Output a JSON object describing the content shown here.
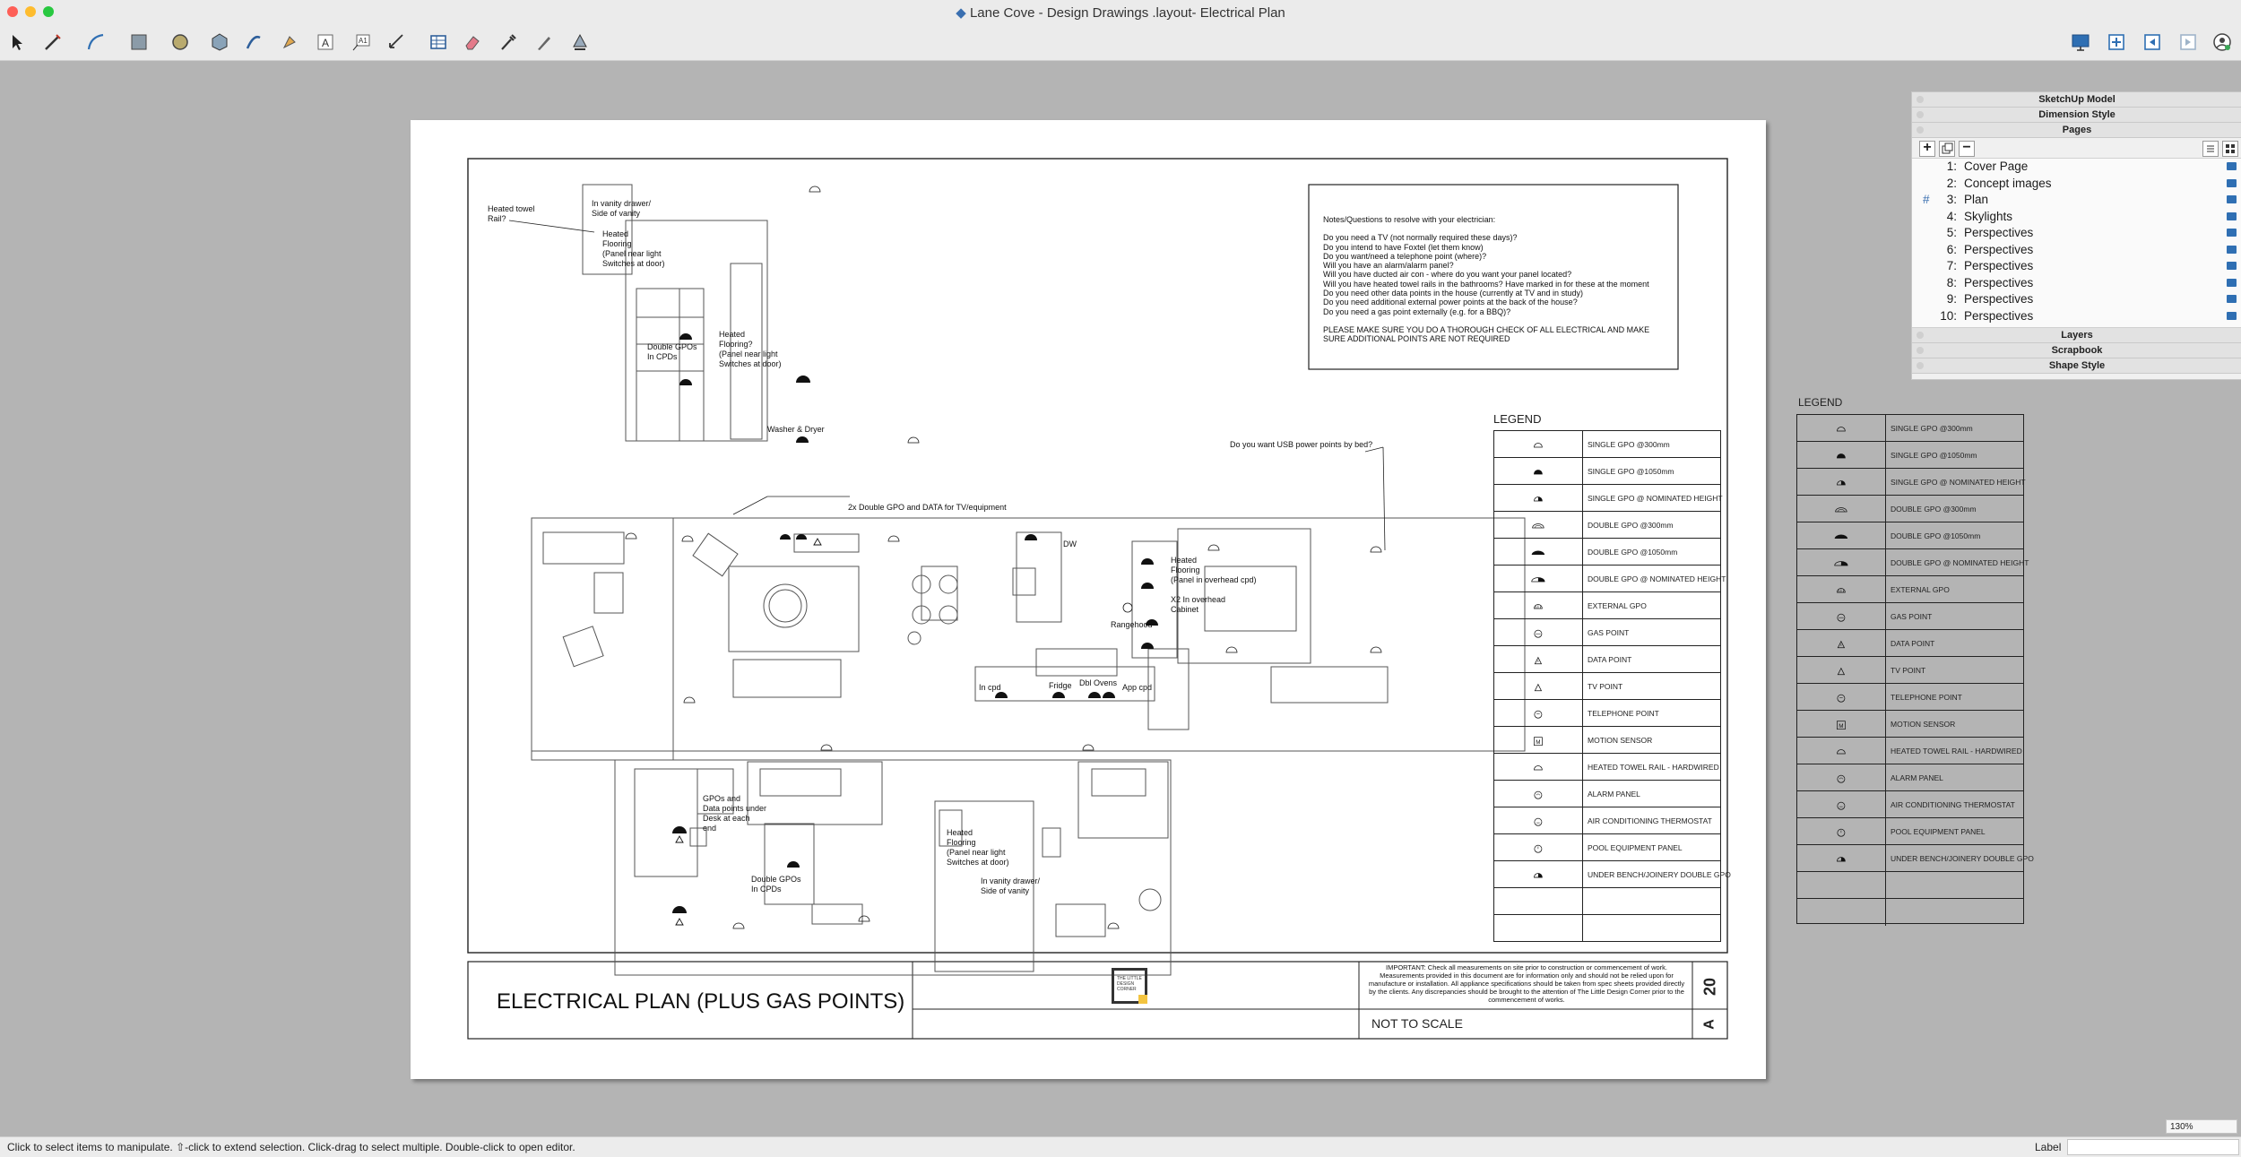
{
  "window": {
    "title": "Lane Cove - Design Drawings .layout- Electrical Plan",
    "colors": {
      "close": "#fe5f57",
      "minimize": "#febc2e",
      "zoom": "#28c840"
    }
  },
  "toolbar": {
    "left_tools": [
      "select-tool",
      "line-tool",
      "arc-tool",
      "shape-tool",
      "offset-tool",
      "style-tool",
      "sample-paint-tool",
      "erase-tool",
      "text-tool",
      "label-tool",
      "dimension-tool",
      "table-tool",
      "eraser-tool",
      "eyedropper-tool",
      "pen-tool",
      "split-tool"
    ],
    "right_tools": [
      "presentation-icon",
      "add-page-icon",
      "previous-page-icon",
      "next-page-icon",
      "account-icon"
    ]
  },
  "panels": {
    "sketchup_model": "SketchUp Model",
    "dimension_style": "Dimension Style",
    "pages": "Pages",
    "layers": "Layers",
    "scrapbook": "Scrapbook",
    "shape_style": "Shape Style",
    "page_list": [
      {
        "num": "1:",
        "name": "Cover Page",
        "current": false
      },
      {
        "num": "2:",
        "name": "Concept images",
        "current": false
      },
      {
        "num": "3:",
        "name": "Plan",
        "current": true
      },
      {
        "num": "4:",
        "name": "Skylights",
        "current": false
      },
      {
        "num": "5:",
        "name": "Perspectives",
        "current": false
      },
      {
        "num": "6:",
        "name": "Perspectives",
        "current": false
      },
      {
        "num": "7:",
        "name": "Perspectives",
        "current": false
      },
      {
        "num": "8:",
        "name": "Perspectives",
        "current": false
      },
      {
        "num": "9:",
        "name": "Perspectives",
        "current": false
      },
      {
        "num": "10:",
        "name": "Perspectives",
        "current": false
      }
    ],
    "current_marker": "#"
  },
  "drawing": {
    "title": "ELECTRICAL PLAN (PLUS GAS POINTS)",
    "not_to_scale": "NOT TO SCALE",
    "sheet_number": "20",
    "revision": "A",
    "logo_text": "THE LITTLE DESIGN CORNER",
    "important_note": "IMPORTANT: Check all measurements on site prior to construction or commencement of work. Measurements provided in this document are for information only and should not be relied upon for manufacture or installation. All appliance specifications should be taken from spec sheets provided directly by the clients. Any discrepancies should be brought to the attention of The Little Design Corner prior to the commencement of works.",
    "notes_heading": "Notes/Questions to resolve with your electrician:",
    "notes": [
      "Do you need a TV (not normally required these days)?",
      "Do you intend to have Foxtel (let them know)",
      "Do you want/need a telephone point (where)?",
      "Will you have an alarm/alarm panel?",
      "Will you have ducted air con - where do you want your panel located?",
      "Will you have heated towel rails in the bathrooms? Have marked in for these at the moment",
      "Do you need other data points in the house (currently at TV and in study)",
      "Do you need additional external power points at the back of the house?",
      "Do you need a gas point externally (e.g. for a BBQ)?"
    ],
    "notes_footer": "PLEASE MAKE SURE YOU DO A THOROUGH CHECK OF ALL ELECTRICAL AND MAKE SURE ADDITIONAL POINTS ARE NOT REQUIRED",
    "annotations": {
      "towel_rail": "Heated towel\nRail?",
      "vanity_top": "In vanity drawer/\nSide of vanity",
      "heated_floor_top": "Heated\nFlooring\n(Panel near light\nSwitches at door)",
      "heated_floor_mid": "Heated\nFlooring?\n(Panel near light\nSwitches at door)",
      "double_gpos_top": "Double GPOs\nIn CPDs",
      "washer": "Washer & Dryer",
      "usb": "Do you want USB power points by bed?",
      "tv_equipment": "2x Double GPO and DATA for TV/equipment",
      "dw": "DW",
      "heated_floor_kitchen": "Heated\nFlooring\n(Panel in overhead cpd)",
      "rangehood": "Rangehood",
      "x2_overhead": "X2 In overhead\nCabinet",
      "in_cpd": "In cpd",
      "fridge": "Fridge",
      "dbl_ovens": "Dbl Ovens",
      "app_cpd": "App cpd",
      "desk": "GPOs and\nData points under\nDesk at each\nend",
      "double_gpos_bottom": "Double GPOs\nIn CPDs",
      "heated_floor_bottom": "Heated\nFlooring\n(Panel near light\nSwitches at door)",
      "vanity_bottom": "In vanity drawer/\nSide of vanity"
    }
  },
  "legend": {
    "title": "LEGEND",
    "items": [
      {
        "icon": "single-gpo-300-icon",
        "label": "SINGLE GPO @300mm"
      },
      {
        "icon": "single-gpo-1050-icon",
        "label": "SINGLE GPO @1050mm"
      },
      {
        "icon": "single-gpo-nominated-icon",
        "label": "SINGLE GPO @ NOMINATED HEIGHT"
      },
      {
        "icon": "double-gpo-300-icon",
        "label": "DOUBLE GPO @300mm"
      },
      {
        "icon": "double-gpo-1050-icon",
        "label": "DOUBLE GPO @1050mm"
      },
      {
        "icon": "double-gpo-nominated-icon",
        "label": "DOUBLE GPO @ NOMINATED HEIGHT"
      },
      {
        "icon": "external-gpo-icon",
        "label": "EXTERNAL GPO"
      },
      {
        "icon": "gas-point-icon",
        "label": "GAS POINT"
      },
      {
        "icon": "data-point-icon",
        "label": "DATA POINT"
      },
      {
        "icon": "tv-point-icon",
        "label": "TV POINT"
      },
      {
        "icon": "telephone-point-icon",
        "label": "TELEPHONE POINT"
      },
      {
        "icon": "motion-sensor-icon",
        "label": "MOTION SENSOR"
      },
      {
        "icon": "heated-towel-rail-icon",
        "label": "HEATED TOWEL RAIL - HARDWIRED"
      },
      {
        "icon": "alarm-panel-icon",
        "label": "ALARM PANEL"
      },
      {
        "icon": "air-conditioning-thermostat-icon",
        "label": "AIR CONDITIONING THERMOSTAT"
      },
      {
        "icon": "pool-equipment-panel-icon",
        "label": "POOL EQUIPMENT PANEL"
      },
      {
        "icon": "under-bench-double-gpo-icon",
        "label": "UNDER BENCH/JOINERY DOUBLE GPO"
      }
    ],
    "motion_sensor_symbol": "M"
  },
  "status": {
    "hint": "Click to select items to manipulate. ⇧-click to extend selection. Click-drag to select multiple. Double-click to open editor.",
    "label_caption": "Label",
    "zoom": "130%"
  }
}
